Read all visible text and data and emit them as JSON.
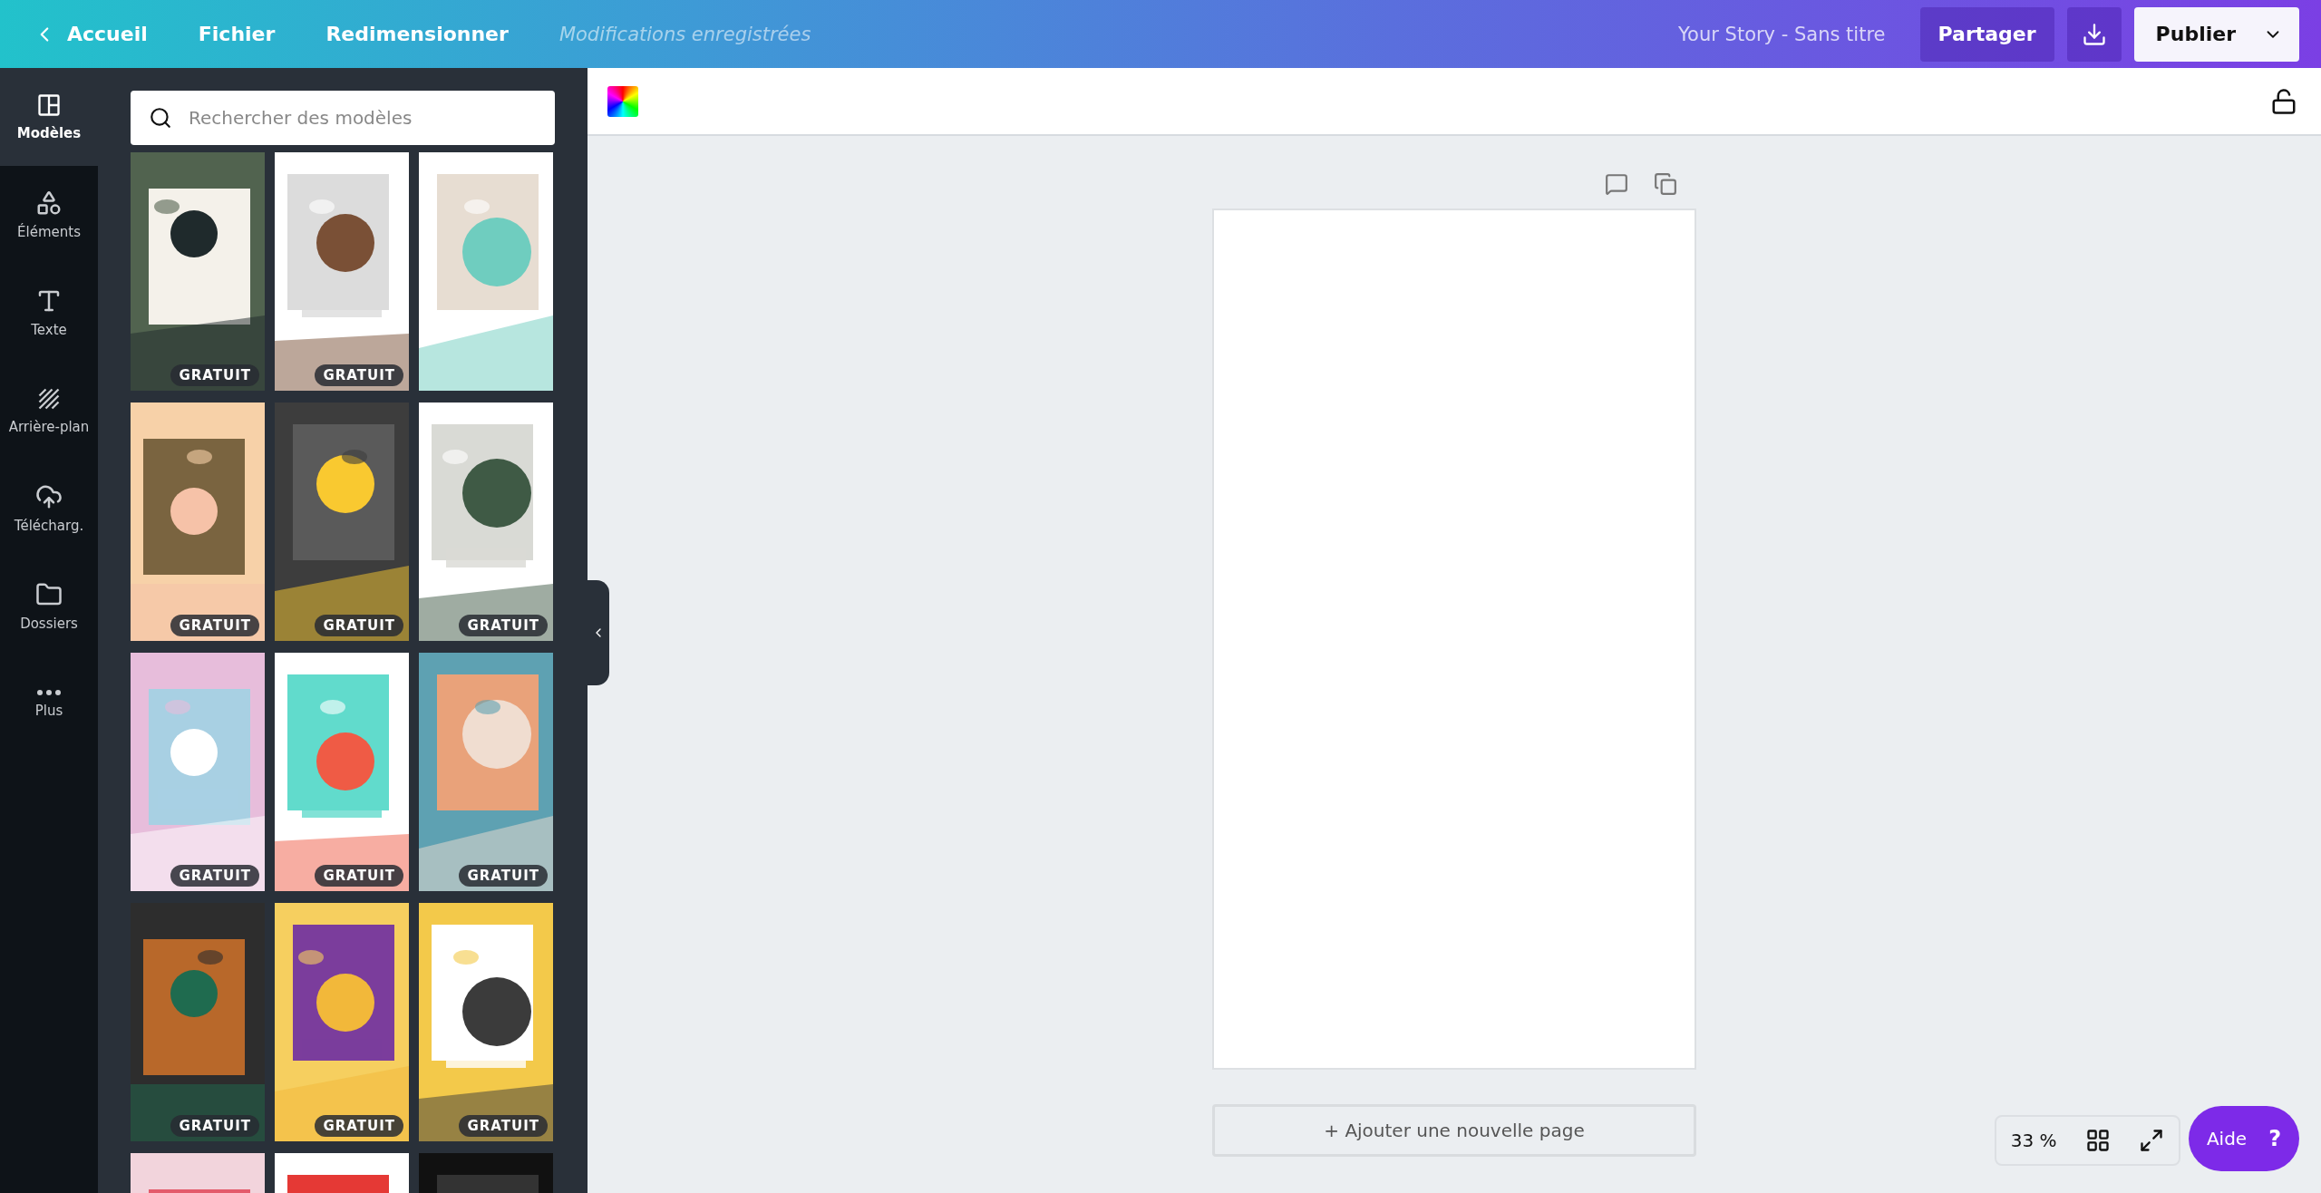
{
  "top_bar": {
    "back": "Accueil",
    "menu": [
      "Fichier",
      "Redimensionner"
    ],
    "save_status": "Modifications enregistrées",
    "doc_title": "Your Story - Sans titre",
    "share": "Partager",
    "publish": "Publier"
  },
  "sidebar": {
    "items": [
      {
        "label": "Modèles",
        "selected": true
      },
      {
        "label": "Éléments",
        "selected": false
      },
      {
        "label": "Texte",
        "selected": false
      },
      {
        "label": "Arrière-plan",
        "selected": false
      },
      {
        "label": "Télécharg.",
        "selected": false
      },
      {
        "label": "Dossiers",
        "selected": false
      },
      {
        "label": "Plus",
        "selected": false
      }
    ]
  },
  "search": {
    "placeholder": "Rechercher des modèles"
  },
  "templates": [
    {
      "kind": "picture",
      "badge": "GRATUIT"
    },
    {
      "kind": "picture",
      "badge": "GRATUIT"
    },
    {
      "kind": "picture"
    },
    {
      "kind": "picture",
      "badge": "GRATUIT"
    },
    {
      "kind": "picture",
      "badge": "GRATUIT"
    },
    {
      "kind": "picture",
      "badge": "GRATUIT"
    },
    {
      "kind": "picture",
      "badge": "GRATUIT"
    },
    {
      "kind": "picture",
      "badge": "GRATUIT"
    },
    {
      "kind": "picture",
      "badge": "GRATUIT"
    },
    {
      "kind": "picture",
      "badge": "GRATUIT"
    },
    {
      "kind": "picture",
      "badge": "GRATUIT"
    },
    {
      "kind": "picture",
      "badge": "GRATUIT"
    },
    {
      "kind": "picture"
    },
    {
      "kind": "picture"
    },
    {
      "kind": "picture"
    }
  ],
  "editor": {
    "add_page": "+ Ajouter une nouvelle page",
    "zoom": "33 %",
    "help": "Aide",
    "help_mark": "?"
  }
}
